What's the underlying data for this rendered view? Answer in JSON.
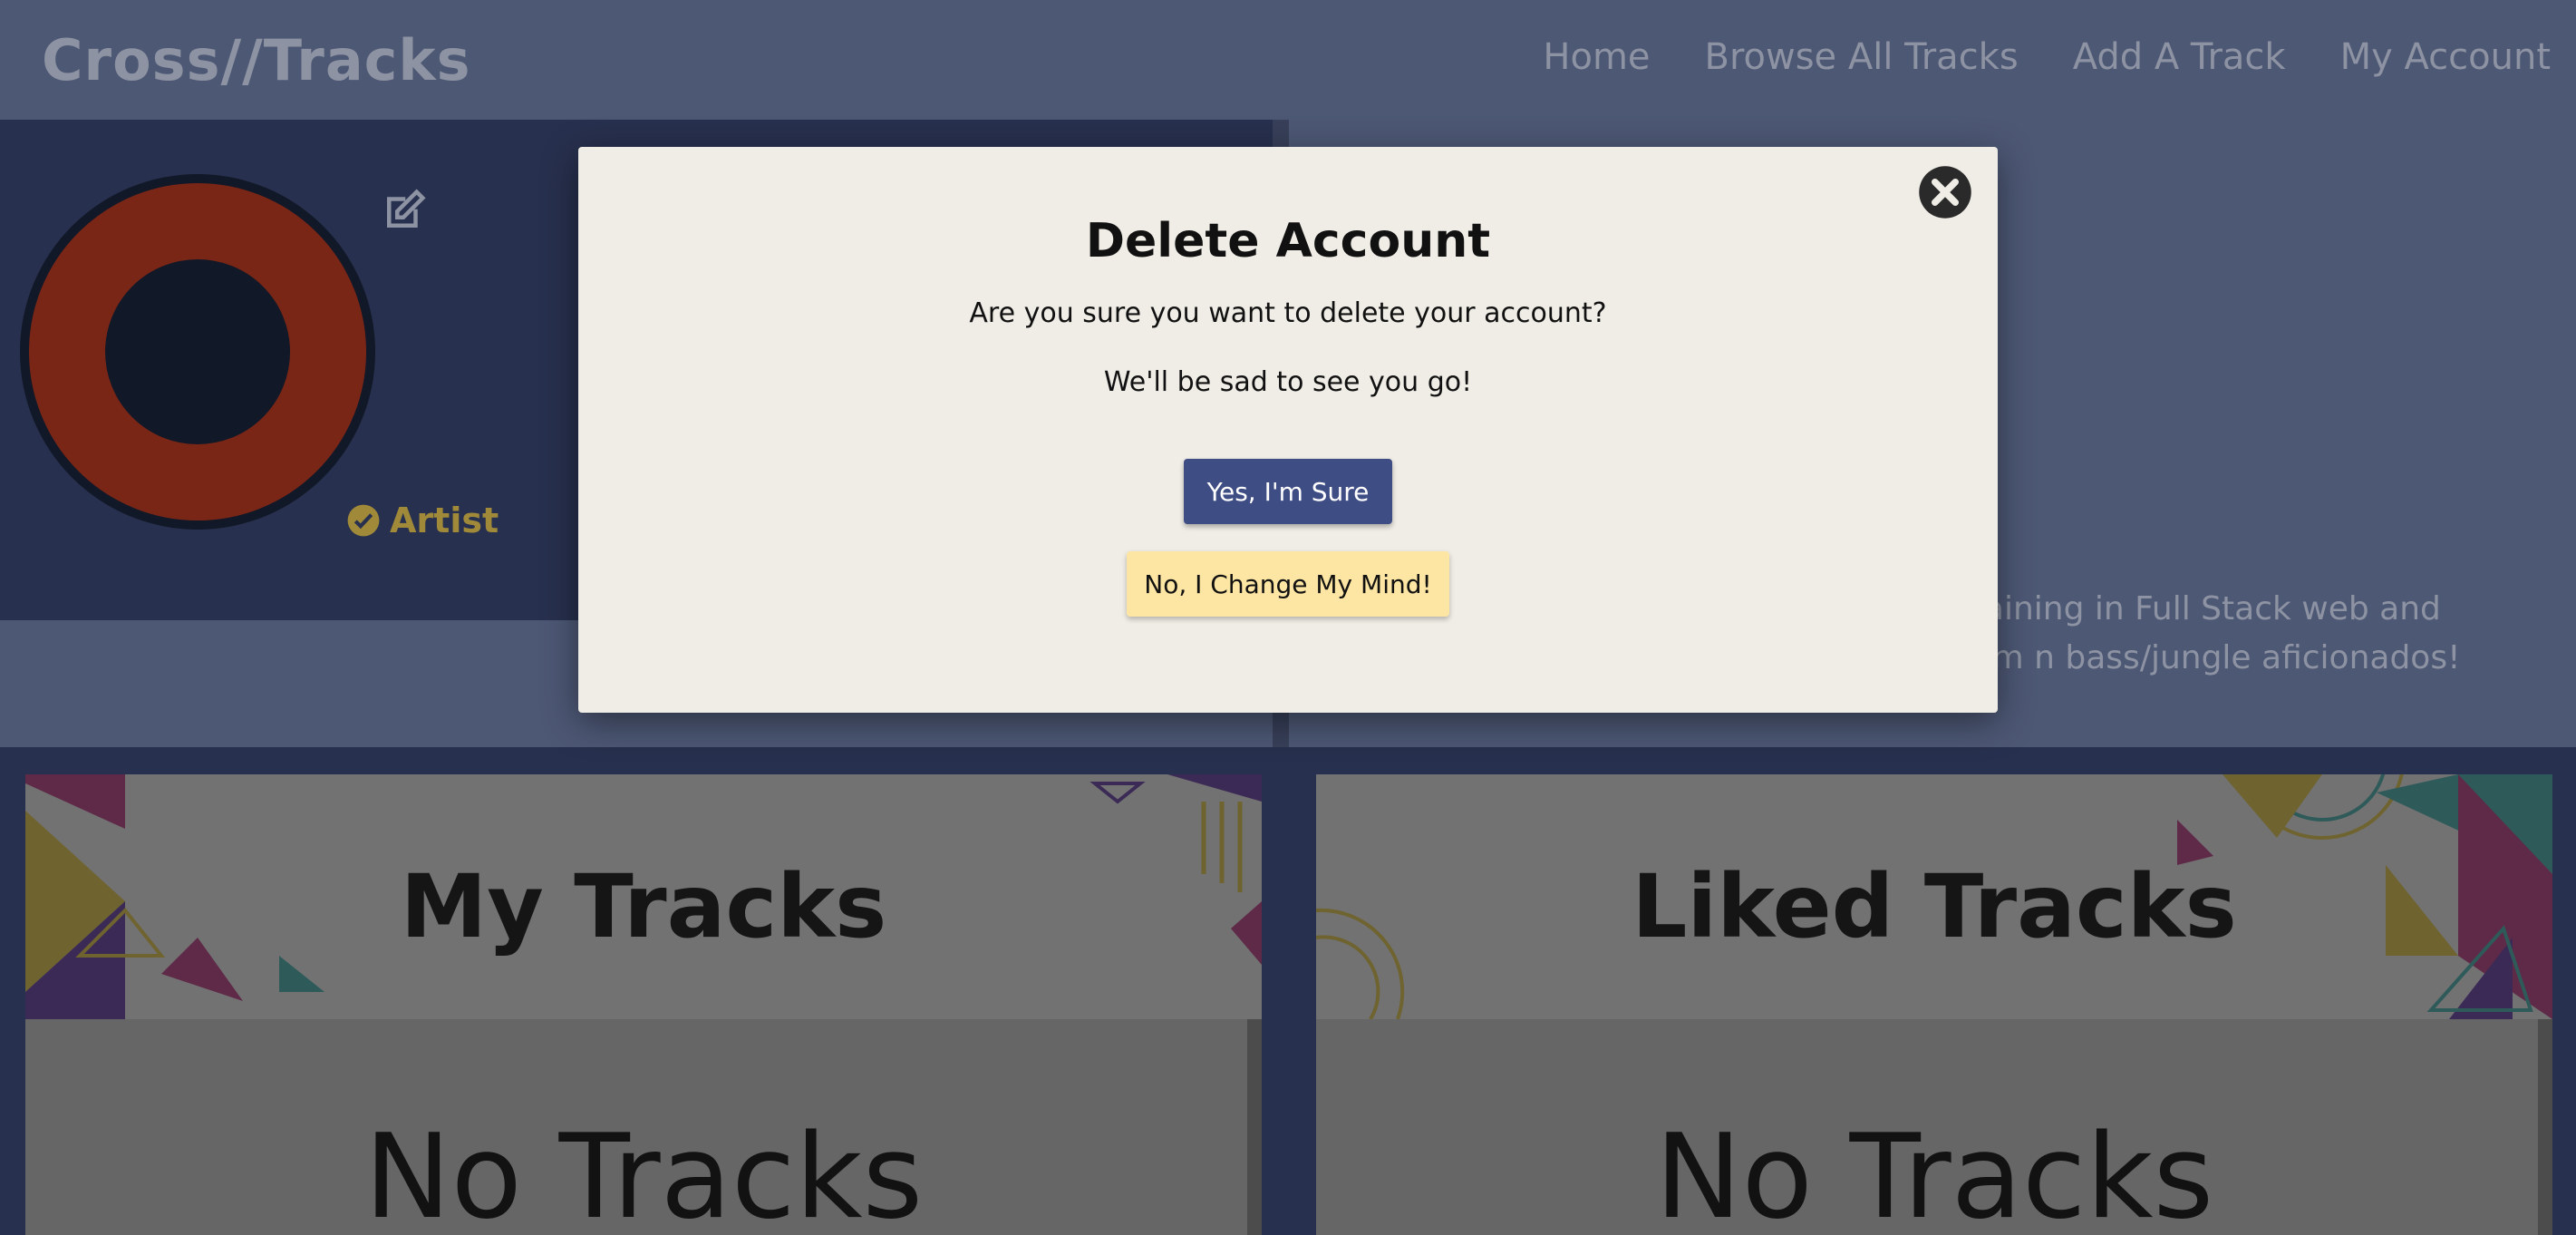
{
  "app": {
    "brand": "Cross//Tracks"
  },
  "nav": {
    "items": [
      "Home",
      "Browse All Tracks",
      "Add A Track",
      "My Account"
    ]
  },
  "profile": {
    "badge_label": "Artist",
    "bio_line1": "training in Full Stack web and",
    "bio_line2": "rum n bass/jungle aficionados!"
  },
  "panels": {
    "my_tracks": {
      "title": "My Tracks",
      "empty_text": "No Tracks"
    },
    "liked_tracks": {
      "title": "Liked Tracks",
      "empty_text": "No Tracks"
    }
  },
  "modal": {
    "title": "Delete Account",
    "message": "Are you sure you want to delete your account?",
    "submessage": "We'll be sad to see you go!",
    "confirm_label": "Yes, I'm Sure",
    "cancel_label": "No, I Change My Mind!"
  },
  "colors": {
    "navbar": "#4d5875",
    "primary_button": "#3f4d85",
    "secondary_button": "#fde6a3",
    "modal_background": "#f0ede6",
    "avatar_ring": "#7a2617",
    "badge": "#a08a3a"
  },
  "icons": {
    "close": "close-circle-icon",
    "edit": "edit-icon",
    "badge": "check-circle-icon"
  }
}
